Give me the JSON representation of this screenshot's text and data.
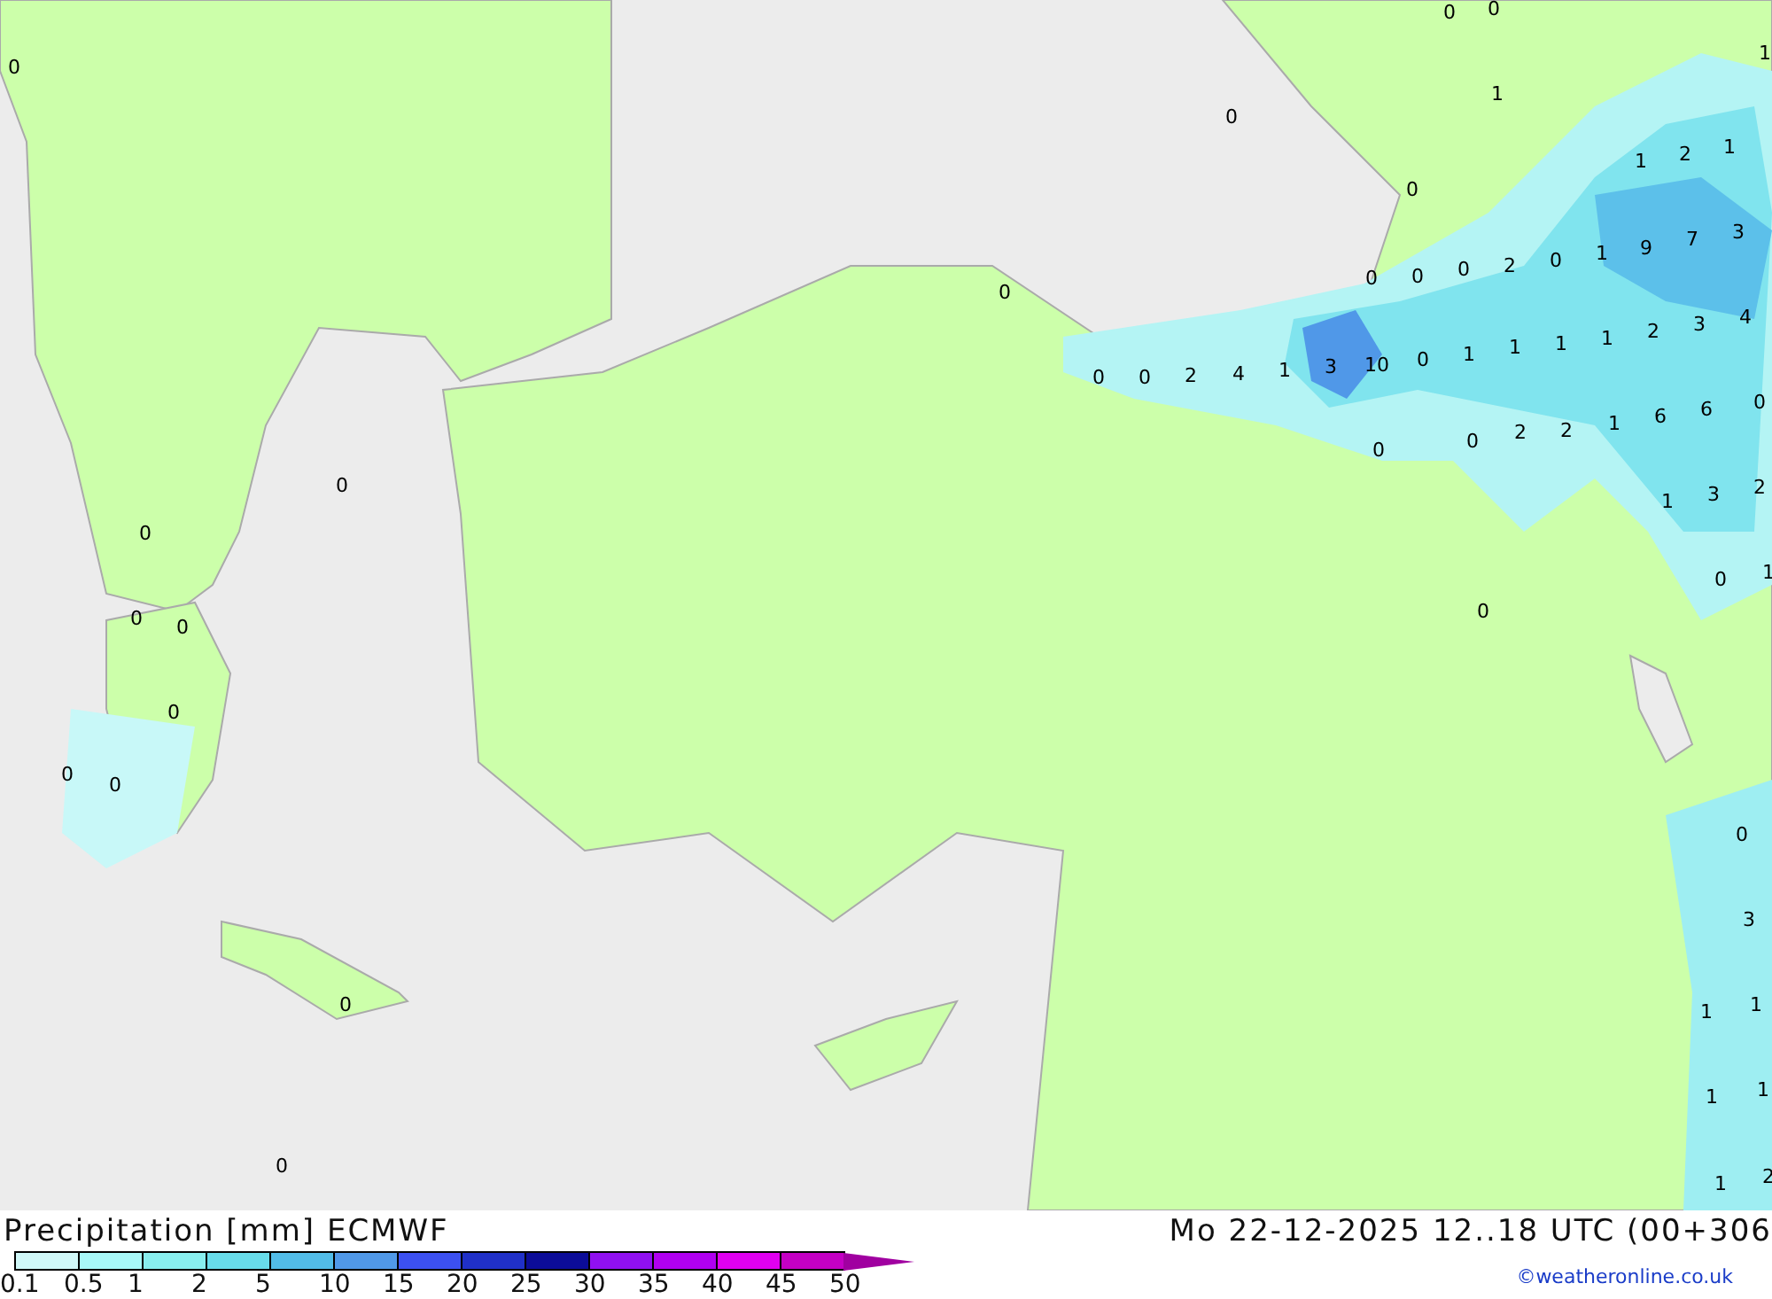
{
  "map": {
    "values": [
      "0",
      "0",
      "0",
      "1",
      "1",
      "0",
      "1",
      "2",
      "1",
      "0",
      "9",
      "7",
      "3",
      "0",
      "0",
      "0",
      "0",
      "2",
      "0",
      "1",
      "0",
      "0",
      "2",
      "4",
      "1",
      "3",
      "10",
      "0",
      "1",
      "1",
      "1",
      "1",
      "2",
      "3",
      "4",
      "0",
      "0",
      "2",
      "2",
      "1",
      "6",
      "6",
      "0",
      "1",
      "3",
      "2",
      "0",
      "1",
      "0",
      "0",
      "0",
      "0",
      "0",
      "0",
      "0",
      "0",
      "0",
      "3",
      "1",
      "1",
      "1",
      "1",
      "1",
      "2",
      "0",
      "0"
    ]
  },
  "footer": {
    "title": "Precipitation [mm] ECMWF",
    "datetime": "Mo 22-12-2025 12..18 UTC (00+306",
    "credit": "©weatheronline.co.uk"
  },
  "legend": {
    "steps": [
      {
        "color": "#d0f8f8"
      },
      {
        "color": "#a8f8f8"
      },
      {
        "color": "#88eeee"
      },
      {
        "color": "#68dcea"
      },
      {
        "color": "#52bce8"
      },
      {
        "color": "#5098e8"
      },
      {
        "color": "#3c50f0"
      },
      {
        "color": "#2030c8"
      },
      {
        "color": "#0c0c98"
      },
      {
        "color": "#9010f0"
      },
      {
        "color": "#b000f0"
      },
      {
        "color": "#e000f0"
      },
      {
        "color": "#c400c4"
      }
    ],
    "ticks": [
      "0.1",
      "0.5",
      "1",
      "2",
      "5",
      "10",
      "15",
      "20",
      "25",
      "30",
      "35",
      "40",
      "45",
      "50"
    ]
  }
}
